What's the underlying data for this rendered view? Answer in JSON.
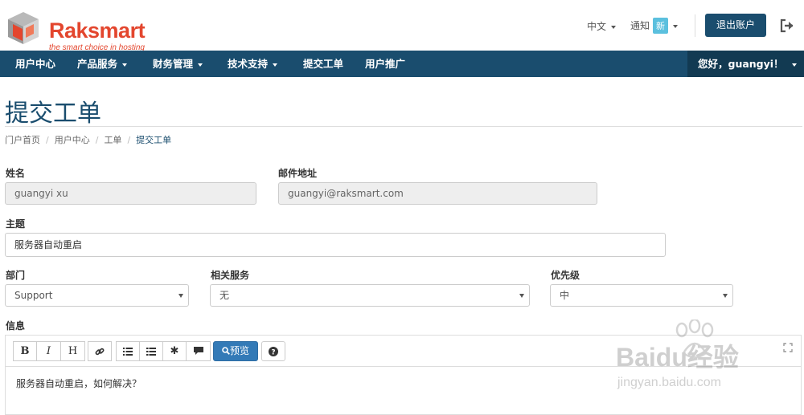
{
  "brand": {
    "name": "Raksmart",
    "tagline": "the smart choice in hosting"
  },
  "header": {
    "language": "中文",
    "notifications_label": "通知",
    "notifications_badge": "新",
    "logout_label": "退出账户"
  },
  "nav": {
    "items": [
      {
        "label": "用户中心",
        "dropdown": false
      },
      {
        "label": "产品服务",
        "dropdown": true
      },
      {
        "label": "财务管理",
        "dropdown": true
      },
      {
        "label": "技术支持",
        "dropdown": true
      },
      {
        "label": "提交工单",
        "dropdown": false
      },
      {
        "label": "用户推广",
        "dropdown": false
      }
    ],
    "user_greeting": "您好，guangyi！"
  },
  "page": {
    "title": "提交工单",
    "breadcrumb": [
      "门户首页",
      "用户中心",
      "工单",
      "提交工单"
    ]
  },
  "form": {
    "name_label": "姓名",
    "name_value": "guangyi xu",
    "email_label": "邮件地址",
    "email_value": "guangyi@raksmart.com",
    "subject_label": "主题",
    "subject_value": "服务器自动重启",
    "department_label": "部门",
    "department_value": "Support",
    "service_label": "相关服务",
    "service_value": "无",
    "priority_label": "优先级",
    "priority_value": "中",
    "message_label": "信息"
  },
  "editor": {
    "buttons": [
      "B",
      "I",
      "H"
    ],
    "preview_label": "预览",
    "content": "服务器自动重启，如何解决？"
  },
  "watermark": {
    "text": "Baidu经验",
    "subtext": "jingyan.baidu.com"
  },
  "colors": {
    "primary": "#1a4d6e",
    "brand_red": "#e3462e",
    "badge": "#5bc0de",
    "preview_btn": "#337ab7"
  }
}
